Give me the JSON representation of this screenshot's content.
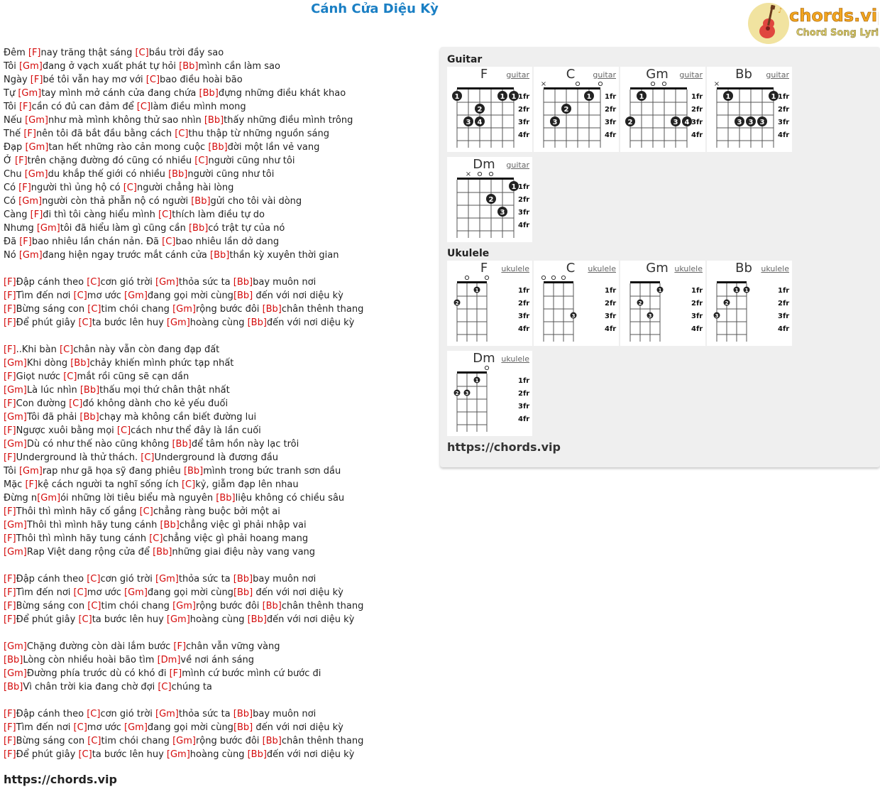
{
  "song_title": "Cánh Cửa Diệu Kỳ",
  "logo": {
    "brand": "chords.vip",
    "tagline": "Chord Song Lyric"
  },
  "lyrics": [
    [
      {
        "t": "Đêm "
      },
      {
        "c": "F"
      },
      {
        "t": "nay trăng thật sáng "
      },
      {
        "c": "C"
      },
      {
        "t": "bầu trời đầy sao"
      }
    ],
    [
      {
        "t": "Tôi "
      },
      {
        "c": "Gm"
      },
      {
        "t": "đang ở vạch xuất phát tự hỏi "
      },
      {
        "c": "Bb"
      },
      {
        "t": "mình cần làm sao"
      }
    ],
    [
      {
        "t": "Ngày "
      },
      {
        "c": "F"
      },
      {
        "t": "bé tôi vẫn hay mơ với "
      },
      {
        "c": "C"
      },
      {
        "t": "bao điều hoài bão"
      }
    ],
    [
      {
        "t": "Tự "
      },
      {
        "c": "Gm"
      },
      {
        "t": "tay mình mở cánh cửa đang chứa "
      },
      {
        "c": "Bb"
      },
      {
        "t": "đựng những điều khát khao"
      }
    ],
    [
      {
        "t": "Tôi "
      },
      {
        "c": "F"
      },
      {
        "t": "cần có đủ can đảm để "
      },
      {
        "c": "C"
      },
      {
        "t": "làm điều mình mong"
      }
    ],
    [
      {
        "t": "Nếu "
      },
      {
        "c": "Gm"
      },
      {
        "t": "như mà mình không thử sao nhìn "
      },
      {
        "c": "Bb"
      },
      {
        "t": "thấy những điều mình trông"
      }
    ],
    [
      {
        "t": "Thế "
      },
      {
        "c": "F"
      },
      {
        "t": "nên tôi đã bắt đầu bằng cách "
      },
      {
        "c": "C"
      },
      {
        "t": "thu thập từ những nguồn sáng"
      }
    ],
    [
      {
        "t": "Đạp "
      },
      {
        "c": "Gm"
      },
      {
        "t": "tan hết những rào cản mong cuộc "
      },
      {
        "c": "Bb"
      },
      {
        "t": "đời một lần vẻ vang"
      }
    ],
    [
      {
        "t": "Ở "
      },
      {
        "c": "F"
      },
      {
        "t": "trên chặng đường đó cũng có nhiều "
      },
      {
        "c": "C"
      },
      {
        "t": "người cũng như tôi"
      }
    ],
    [
      {
        "t": "Chu "
      },
      {
        "c": "Gm"
      },
      {
        "t": "du khắp thế giới có nhiều "
      },
      {
        "c": "Bb"
      },
      {
        "t": "người cũng như tôi"
      }
    ],
    [
      {
        "t": "Có "
      },
      {
        "c": "F"
      },
      {
        "t": "người thì ủng hộ có "
      },
      {
        "c": "C"
      },
      {
        "t": "người chẳng hài lòng"
      }
    ],
    [
      {
        "t": "Có "
      },
      {
        "c": "Gm"
      },
      {
        "t": "người còn thả phẫn nộ có người "
      },
      {
        "c": "Bb"
      },
      {
        "t": "gửi cho tôi vài dòng"
      }
    ],
    [
      {
        "t": "Càng "
      },
      {
        "c": "F"
      },
      {
        "t": "đi thì tôi càng hiểu mình "
      },
      {
        "c": "C"
      },
      {
        "t": "thích làm điều tự do"
      }
    ],
    [
      {
        "t": "Nhưng "
      },
      {
        "c": "Gm"
      },
      {
        "t": "tôi đã hiểu làm gì cũng cần "
      },
      {
        "c": "Bb"
      },
      {
        "t": "có trật tự của nó"
      }
    ],
    [
      {
        "t": "Đã "
      },
      {
        "c": "F"
      },
      {
        "t": "bao nhiêu lần chán nản. Đã "
      },
      {
        "c": "C"
      },
      {
        "t": "bao nhiêu lần dở dang"
      }
    ],
    [
      {
        "t": "Nó "
      },
      {
        "c": "Gm"
      },
      {
        "t": "đang hiện ngay trước mắt cánh cửa "
      },
      {
        "c": "Bb"
      },
      {
        "t": "thần kỳ xuyên thời gian"
      }
    ],
    [],
    [
      {
        "c": "F"
      },
      {
        "t": "Đập cánh theo "
      },
      {
        "c": "C"
      },
      {
        "t": "cơn gió trời "
      },
      {
        "c": "Gm"
      },
      {
        "t": "thỏa sức ta "
      },
      {
        "c": "Bb"
      },
      {
        "t": "bay muôn nơi"
      }
    ],
    [
      {
        "c": "F"
      },
      {
        "t": "Tìm đến nơi "
      },
      {
        "c": "C"
      },
      {
        "t": "mơ ước "
      },
      {
        "c": "Gm"
      },
      {
        "t": "đang gọi mời cùng"
      },
      {
        "c": "Bb"
      },
      {
        "t": " đến với nơi diệu kỳ"
      }
    ],
    [
      {
        "c": "F"
      },
      {
        "t": "Bừng sáng con "
      },
      {
        "c": "C"
      },
      {
        "t": "tim chói chang "
      },
      {
        "c": "Gm"
      },
      {
        "t": "rộng bước đôi "
      },
      {
        "c": "Bb"
      },
      {
        "t": "chân thênh thang"
      }
    ],
    [
      {
        "c": "F"
      },
      {
        "t": "Để phút giây "
      },
      {
        "c": "C"
      },
      {
        "t": "ta bước lên huy "
      },
      {
        "c": "Gm"
      },
      {
        "t": "hoàng cùng "
      },
      {
        "c": "Bb"
      },
      {
        "t": "đến với nơi diệu kỳ"
      }
    ],
    [],
    [
      {
        "c": "F"
      },
      {
        "t": "..Khi bàn "
      },
      {
        "c": "C"
      },
      {
        "t": "chân này vẫn còn đang đạp đất"
      }
    ],
    [
      {
        "c": "Gm"
      },
      {
        "t": "Khi dòng "
      },
      {
        "c": "Bb"
      },
      {
        "t": "chảy khiến mình phức tạp nhất"
      }
    ],
    [
      {
        "c": "F"
      },
      {
        "t": "Giọt nước "
      },
      {
        "c": "C"
      },
      {
        "t": "mắt rồi cũng sẽ cạn dần"
      }
    ],
    [
      {
        "c": "Gm"
      },
      {
        "t": "Là lúc nhìn "
      },
      {
        "c": "Bb"
      },
      {
        "t": "thấu mọi thứ chân thật nhất"
      }
    ],
    [
      {
        "c": "F"
      },
      {
        "t": "Con đường "
      },
      {
        "c": "C"
      },
      {
        "t": "đó không dành cho kẻ yếu đuối"
      }
    ],
    [
      {
        "c": "Gm"
      },
      {
        "t": "Tôi đã phải "
      },
      {
        "c": "Bb"
      },
      {
        "t": "chạy mà không cần biết đường lui"
      }
    ],
    [
      {
        "c": "F"
      },
      {
        "t": "Ngược xuôi bằng mọi "
      },
      {
        "c": "C"
      },
      {
        "t": "cách như thể đây là lần cuối"
      }
    ],
    [
      {
        "c": "Gm"
      },
      {
        "t": "Dù có như thế nào cũng không "
      },
      {
        "c": "Bb"
      },
      {
        "t": "để tâm hồn này lạc trôi"
      }
    ],
    [
      {
        "c": "F"
      },
      {
        "t": "Underground là thử thách. "
      },
      {
        "c": "C"
      },
      {
        "t": "Underground là đương đầu"
      }
    ],
    [
      {
        "t": "Tôi "
      },
      {
        "c": "Gm"
      },
      {
        "t": "rap như gã họa sỹ đang phiêu "
      },
      {
        "c": "Bb"
      },
      {
        "t": "mình trong bức tranh sơn dầu"
      }
    ],
    [
      {
        "t": "Mặc "
      },
      {
        "c": "F"
      },
      {
        "t": "kệ cách người ta nghĩ sống ích "
      },
      {
        "c": "C"
      },
      {
        "t": "kỷ, giẫm đạp lên nhau"
      }
    ],
    [
      {
        "t": "Đừng n"
      },
      {
        "c": "Gm"
      },
      {
        "t": "ói những lời tiêu biểu mà nguyên "
      },
      {
        "c": "Bb"
      },
      {
        "t": "liệu không có chiều sâu"
      }
    ],
    [
      {
        "c": "F"
      },
      {
        "t": "Thôi thì mình hãy cố gắng "
      },
      {
        "c": "C"
      },
      {
        "t": "chẳng ràng buộc bởi một ai"
      }
    ],
    [
      {
        "c": "Gm"
      },
      {
        "t": "Thôi thì mình hãy tung cánh "
      },
      {
        "c": "Bb"
      },
      {
        "t": "chẳng việc gì phải nhập vai"
      }
    ],
    [
      {
        "c": "F"
      },
      {
        "t": "Thôi thì mình hãy tung cánh "
      },
      {
        "c": "C"
      },
      {
        "t": "chẳng việc gì phải hoang mang"
      }
    ],
    [
      {
        "c": "Gm"
      },
      {
        "t": "Rap Việt dang rộng cửa để "
      },
      {
        "c": "Bb"
      },
      {
        "t": "những giai điệu này vang vang"
      }
    ],
    [],
    [
      {
        "c": "F"
      },
      {
        "t": "Đập cánh theo "
      },
      {
        "c": "C"
      },
      {
        "t": "cơn gió trời "
      },
      {
        "c": "Gm"
      },
      {
        "t": "thỏa sức ta "
      },
      {
        "c": "Bb"
      },
      {
        "t": "bay muôn nơi"
      }
    ],
    [
      {
        "c": "F"
      },
      {
        "t": "Tìm đến nơi "
      },
      {
        "c": "C"
      },
      {
        "t": "mơ ước "
      },
      {
        "c": "Gm"
      },
      {
        "t": "đang gọi mời cùng"
      },
      {
        "c": "Bb"
      },
      {
        "t": " đến với nơi diệu kỳ"
      }
    ],
    [
      {
        "c": "F"
      },
      {
        "t": "Bừng sáng con "
      },
      {
        "c": "C"
      },
      {
        "t": "tim chói chang "
      },
      {
        "c": "Gm"
      },
      {
        "t": "rộng bước đôi "
      },
      {
        "c": "Bb"
      },
      {
        "t": "chân thênh thang"
      }
    ],
    [
      {
        "c": "F"
      },
      {
        "t": "Để phút giây "
      },
      {
        "c": "C"
      },
      {
        "t": "ta bước lên huy "
      },
      {
        "c": "Gm"
      },
      {
        "t": "hoàng cùng "
      },
      {
        "c": "Bb"
      },
      {
        "t": "đến với nơi diệu kỳ"
      }
    ],
    [],
    [
      {
        "c": "Gm"
      },
      {
        "t": "Chặng đường còn dài lắm bước "
      },
      {
        "c": "F"
      },
      {
        "t": "chân vẫn vững vàng"
      }
    ],
    [
      {
        "c": "Bb"
      },
      {
        "t": "Lòng còn nhiều hoài bão tìm "
      },
      {
        "c": "Dm"
      },
      {
        "t": "về nơi ánh sáng"
      }
    ],
    [
      {
        "c": "Gm"
      },
      {
        "t": "Đường phía trước dù có khó đi "
      },
      {
        "c": "F"
      },
      {
        "t": "mình cứ bước mình cứ bước đi"
      }
    ],
    [
      {
        "c": "Bb"
      },
      {
        "t": "Vì chân trời kia đang chờ đợi "
      },
      {
        "c": "C"
      },
      {
        "t": "chúng ta"
      }
    ],
    [],
    [
      {
        "c": "F"
      },
      {
        "t": "Đập cánh theo "
      },
      {
        "c": "C"
      },
      {
        "t": "cơn gió trời "
      },
      {
        "c": "Gm"
      },
      {
        "t": "thỏa sức ta "
      },
      {
        "c": "Bb"
      },
      {
        "t": "bay muôn nơi"
      }
    ],
    [
      {
        "c": "F"
      },
      {
        "t": "Tìm đến nơi "
      },
      {
        "c": "C"
      },
      {
        "t": "mơ ước "
      },
      {
        "c": "Gm"
      },
      {
        "t": "đang gọi mời cùng"
      },
      {
        "c": "Bb"
      },
      {
        "t": " đến với nơi diệu kỳ"
      }
    ],
    [
      {
        "c": "F"
      },
      {
        "t": "Bừng sáng con "
      },
      {
        "c": "C"
      },
      {
        "t": "tim chói chang "
      },
      {
        "c": "Gm"
      },
      {
        "t": "rộng bước đôi "
      },
      {
        "c": "Bb"
      },
      {
        "t": "chân thênh thang"
      }
    ],
    [
      {
        "c": "F"
      },
      {
        "t": "Để phút giây "
      },
      {
        "c": "C"
      },
      {
        "t": "ta bước lên huy "
      },
      {
        "c": "Gm"
      },
      {
        "t": "hoàng cùng "
      },
      {
        "c": "Bb"
      },
      {
        "t": "đến với nơi diệu kỳ"
      }
    ]
  ],
  "footer_link": "https://chords.vip",
  "panel": {
    "guitar_title": "Guitar",
    "ukulele_title": "Ukulele",
    "link": "https://chords.vip",
    "fret_labels": [
      "1fr",
      "2fr",
      "3fr",
      "4fr"
    ],
    "guitar_chords": [
      {
        "name": "F",
        "link": "guitar",
        "open": [],
        "mute": [],
        "dots": [
          {
            "s": 1,
            "f": 1,
            "n": "1"
          },
          {
            "s": 3,
            "f": 2,
            "n": "2"
          },
          {
            "s": 2,
            "f": 3,
            "n": "3"
          },
          {
            "s": 3,
            "f": 3,
            "n": "4"
          },
          {
            "s": 5,
            "f": 1,
            "n": "1"
          },
          {
            "s": 6,
            "f": 1,
            "n": "1"
          }
        ]
      },
      {
        "name": "C",
        "link": "guitar",
        "open": [
          4,
          6
        ],
        "mute": [
          1
        ],
        "dots": [
          {
            "s": 2,
            "f": 3,
            "n": "3"
          },
          {
            "s": 3,
            "f": 2,
            "n": "2"
          },
          {
            "s": 5,
            "f": 1,
            "n": "1"
          }
        ]
      },
      {
        "name": "Gm",
        "link": "guitar",
        "open": [
          3,
          4
        ],
        "mute": [],
        "dots": [
          {
            "s": 1,
            "f": 3,
            "n": "2"
          },
          {
            "s": 2,
            "f": 1,
            "n": "1"
          },
          {
            "s": 5,
            "f": 3,
            "n": "3"
          },
          {
            "s": 6,
            "f": 3,
            "n": "4"
          }
        ]
      },
      {
        "name": "Bb",
        "link": "guitar",
        "open": [],
        "mute": [
          1
        ],
        "dots": [
          {
            "s": 2,
            "f": 1,
            "n": "1"
          },
          {
            "s": 3,
            "f": 3,
            "n": "3"
          },
          {
            "s": 4,
            "f": 3,
            "n": "3"
          },
          {
            "s": 5,
            "f": 3,
            "n": "3"
          },
          {
            "s": 6,
            "f": 1,
            "n": "1"
          }
        ]
      },
      {
        "name": "Dm",
        "link": "guitar",
        "open": [
          3,
          4
        ],
        "mute": [
          2
        ],
        "dots": [
          {
            "s": 6,
            "f": 1,
            "n": "1"
          },
          {
            "s": 4,
            "f": 2,
            "n": "2"
          },
          {
            "s": 5,
            "f": 3,
            "n": "3"
          }
        ]
      }
    ],
    "ukulele_chords": [
      {
        "name": "F",
        "link": "ukulele",
        "open": [
          2,
          4
        ],
        "dots": [
          {
            "s": 1,
            "f": 2,
            "n": "2"
          },
          {
            "s": 3,
            "f": 1,
            "n": "1"
          }
        ]
      },
      {
        "name": "C",
        "link": "ukulele",
        "open": [
          1,
          2,
          3
        ],
        "dots": [
          {
            "s": 4,
            "f": 3,
            "n": "3"
          }
        ]
      },
      {
        "name": "Gm",
        "link": "ukulele",
        "open": [],
        "dots": [
          {
            "s": 2,
            "f": 2,
            "n": "2"
          },
          {
            "s": 3,
            "f": 3,
            "n": "3"
          },
          {
            "s": 4,
            "f": 1,
            "n": "1"
          }
        ]
      },
      {
        "name": "Bb",
        "link": "ukulele",
        "open": [],
        "dots": [
          {
            "s": 1,
            "f": 3,
            "n": "3"
          },
          {
            "s": 2,
            "f": 2,
            "n": "2"
          },
          {
            "s": 3,
            "f": 1,
            "n": "1"
          },
          {
            "s": 4,
            "f": 1,
            "n": "1"
          }
        ]
      },
      {
        "name": "Dm",
        "link": "ukulele",
        "open": [
          4
        ],
        "dots": [
          {
            "s": 1,
            "f": 2,
            "n": "2"
          },
          {
            "s": 2,
            "f": 2,
            "n": "3"
          },
          {
            "s": 3,
            "f": 1,
            "n": "1"
          }
        ]
      }
    ]
  }
}
